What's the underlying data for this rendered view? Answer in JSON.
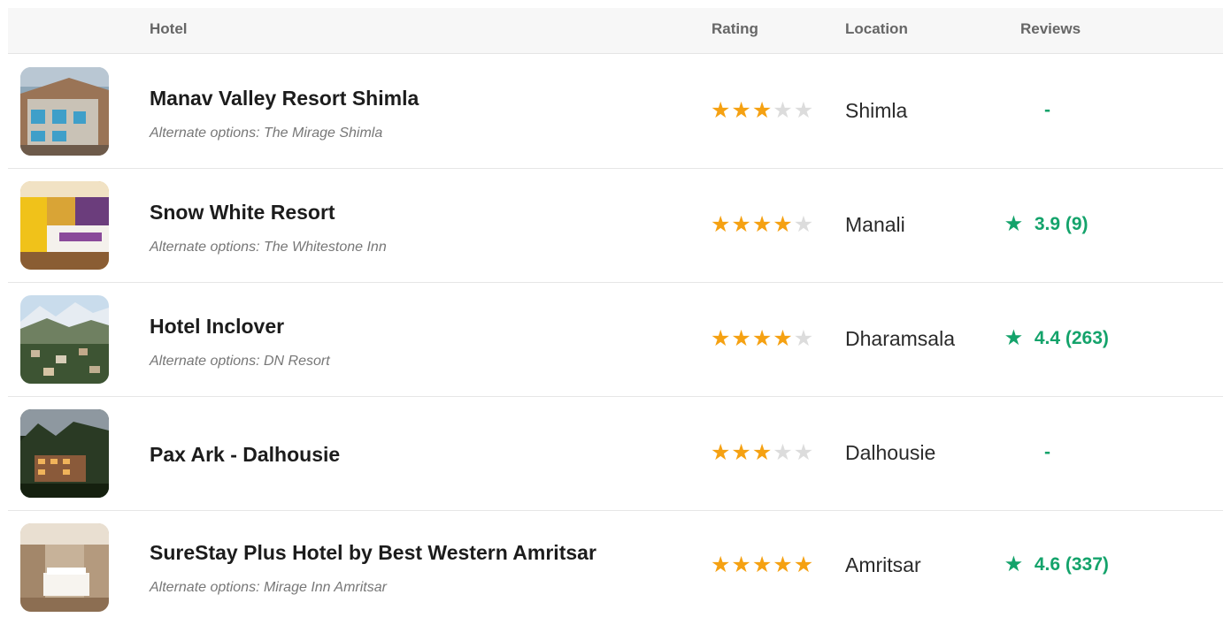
{
  "header": {
    "hotel": "Hotel",
    "rating": "Rating",
    "location": "Location",
    "reviews": "Reviews"
  },
  "colors": {
    "star_on": "#f5a112",
    "star_off": "#dcdcdc",
    "review_green": "#14a36b"
  },
  "hotels": [
    {
      "name": "Manav Valley Resort Shimla",
      "alternate": "Alternate options: The Mirage Shimla",
      "stars": 3,
      "location": "Shimla",
      "review_score": "",
      "review_text": "-"
    },
    {
      "name": "Snow White Resort",
      "alternate": "Alternate options: The Whitestone Inn",
      "stars": 4,
      "location": "Manali",
      "review_score": "★",
      "review_text": "3.9 (9)"
    },
    {
      "name": "Hotel Inclover",
      "alternate": "Alternate options: DN Resort",
      "stars": 4,
      "location": "Dharamsala",
      "review_score": "★",
      "review_text": "4.4 (263)"
    },
    {
      "name": "Pax Ark - Dalhousie",
      "alternate": "",
      "stars": 3,
      "location": "Dalhousie",
      "review_score": "",
      "review_text": "-"
    },
    {
      "name": "SureStay Plus Hotel by Best Western Amritsar",
      "alternate": "Alternate options: Mirage Inn Amritsar",
      "stars": 5,
      "location": "Amritsar",
      "review_score": "★",
      "review_text": "4.6 (337)"
    }
  ]
}
